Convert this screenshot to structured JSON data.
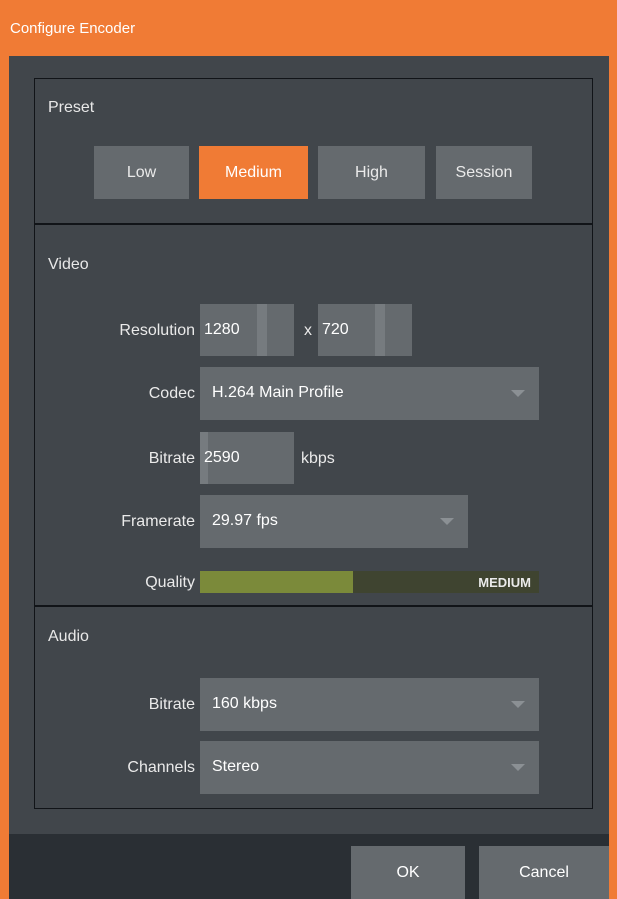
{
  "window": {
    "title": "Configure Encoder"
  },
  "preset": {
    "label": "Preset",
    "buttons": [
      {
        "label": "Low",
        "active": false
      },
      {
        "label": "Medium",
        "active": true
      },
      {
        "label": "High",
        "active": false
      },
      {
        "label": "Session",
        "active": false
      }
    ]
  },
  "video": {
    "label": "Video",
    "resolution": {
      "label": "Resolution",
      "width": "1280",
      "separator": "x",
      "height": "720"
    },
    "codec": {
      "label": "Codec",
      "value": "H.264  Main  Profile"
    },
    "bitrate": {
      "label": "Bitrate",
      "value": "2590",
      "unit": "kbps"
    },
    "framerate": {
      "label": "Framerate",
      "value": "29.97 fps"
    },
    "quality": {
      "label": "Quality",
      "level_text": "MEDIUM",
      "level_fraction": 0.45
    }
  },
  "audio": {
    "label": "Audio",
    "bitrate": {
      "label": "Bitrate",
      "value": "160 kbps"
    },
    "channels": {
      "label": "Channels",
      "value": "Stereo"
    }
  },
  "footer": {
    "ok_label": "OK",
    "cancel_label": "Cancel"
  },
  "colors": {
    "accent": "#f07b35",
    "panel": "#41464b",
    "control": "#656a6e",
    "quality_fill": "#7b8a3a",
    "quality_track": "#3f4430"
  }
}
